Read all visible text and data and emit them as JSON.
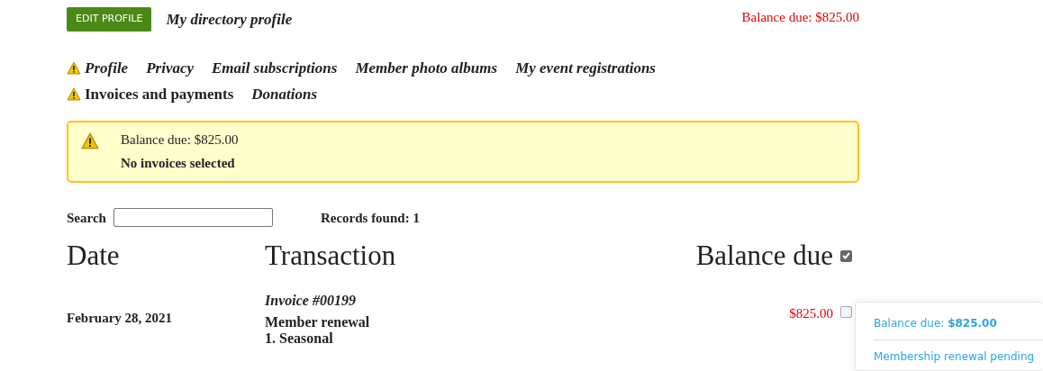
{
  "header": {
    "edit_button": "EDIT PROFILE",
    "title": "My directory profile",
    "balance": "Balance due: $825.00"
  },
  "nav": [
    {
      "label": "Profile",
      "warning": true,
      "italic": true
    },
    {
      "label": "Privacy",
      "warning": false,
      "italic": true
    },
    {
      "label": "Email subscriptions",
      "warning": false,
      "italic": true
    },
    {
      "label": "Member photo albums",
      "warning": false,
      "italic": true
    },
    {
      "label": "My event registrations",
      "warning": false,
      "italic": true
    },
    {
      "label": "Invoices and payments",
      "warning": true,
      "italic": false
    },
    {
      "label": "Donations",
      "warning": false,
      "italic": true
    }
  ],
  "alert": {
    "balance": "Balance due: $825.00",
    "message": "No invoices selected"
  },
  "search": {
    "label": "Search",
    "records": "Records found: 1"
  },
  "table": {
    "columns": [
      "Date",
      "Transaction",
      "Balance due"
    ],
    "select_all_checked": true,
    "rows": [
      {
        "date": "February 28, 2021",
        "invoice": "Invoice #00199",
        "lines": [
          "Member renewal",
          "1. Seasonal"
        ],
        "balance": "$825.00",
        "checked": false
      }
    ]
  },
  "popup": {
    "balance": "Balance due: **$825.00**",
    "status": "Membership renewal pending"
  }
}
